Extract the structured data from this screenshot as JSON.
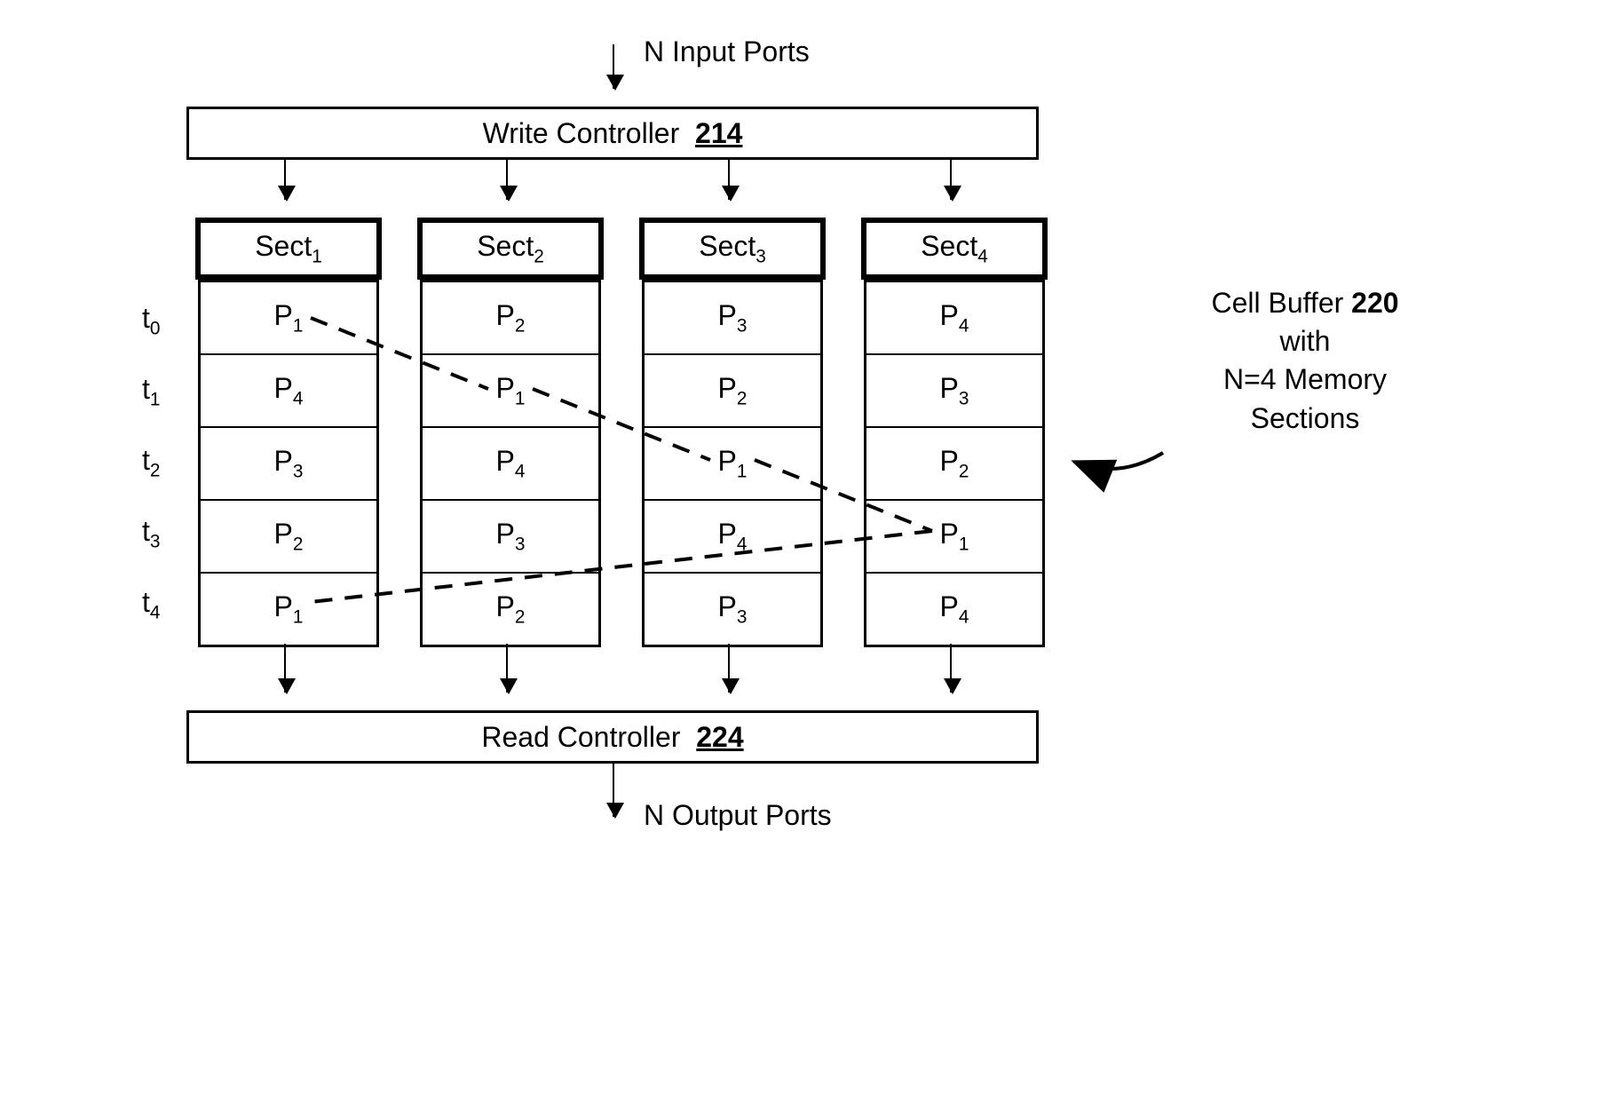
{
  "top_label": "N Input Ports",
  "bottom_label": "N Output Ports",
  "write_controller": {
    "text": "Write Controller",
    "ref": "214"
  },
  "read_controller": {
    "text": "Read Controller",
    "ref": "224"
  },
  "time_labels": [
    "t",
    "t",
    "t",
    "t",
    "t"
  ],
  "time_subs": [
    "0",
    "1",
    "2",
    "3",
    "4"
  ],
  "sections": {
    "headers": [
      "Sect",
      "Sect",
      "Sect",
      "Sect"
    ],
    "header_subs": [
      "1",
      "2",
      "3",
      "4"
    ],
    "columns": [
      [
        {
          "p": "P",
          "s": "1"
        },
        {
          "p": "P",
          "s": "4"
        },
        {
          "p": "P",
          "s": "3"
        },
        {
          "p": "P",
          "s": "2"
        },
        {
          "p": "P",
          "s": "1"
        }
      ],
      [
        {
          "p": "P",
          "s": "2"
        },
        {
          "p": "P",
          "s": "1"
        },
        {
          "p": "P",
          "s": "4"
        },
        {
          "p": "P",
          "s": "3"
        },
        {
          "p": "P",
          "s": "2"
        }
      ],
      [
        {
          "p": "P",
          "s": "3"
        },
        {
          "p": "P",
          "s": "2"
        },
        {
          "p": "P",
          "s": "1"
        },
        {
          "p": "P",
          "s": "4"
        },
        {
          "p": "P",
          "s": "3"
        }
      ],
      [
        {
          "p": "P",
          "s": "4"
        },
        {
          "p": "P",
          "s": "3"
        },
        {
          "p": "P",
          "s": "2"
        },
        {
          "p": "P",
          "s": "1"
        },
        {
          "p": "P",
          "s": "4"
        }
      ]
    ]
  },
  "callout": {
    "line1a": "Cell Buffer ",
    "line1b_ref": "220",
    "line2": "with",
    "line3": "N=4  Memory",
    "line4": "Sections"
  }
}
